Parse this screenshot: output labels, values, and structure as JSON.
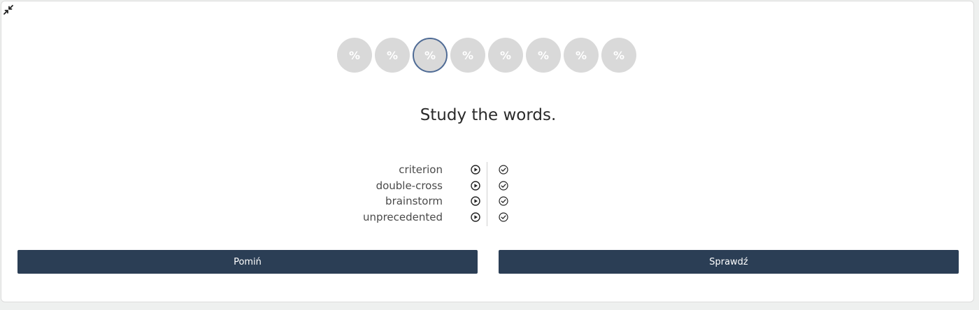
{
  "progress": {
    "bubbles": [
      "%",
      "%",
      "%",
      "%",
      "%",
      "%",
      "%",
      "%"
    ],
    "active_index": 2
  },
  "exercise": {
    "title": "Study the words.",
    "words": [
      "criterion",
      "double-cross",
      "brainstorm",
      "unprecedented"
    ]
  },
  "buttons": {
    "skip_label": "Pomiń",
    "check_label": "Sprawdź"
  },
  "icons": {
    "collapse": "collapse-icon",
    "play": "play-icon",
    "check": "check-circle-icon"
  },
  "colors": {
    "button_bg": "#2b3e55",
    "bubble_bg": "#d9d9d9",
    "active_border": "#4f6b95"
  }
}
